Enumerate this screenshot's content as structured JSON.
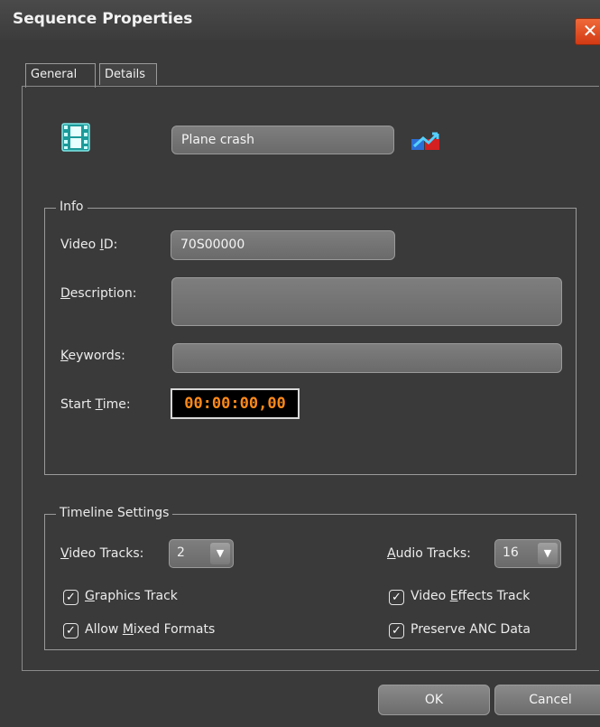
{
  "window": {
    "title": "Sequence Properties",
    "close_glyph": "✕"
  },
  "tabs": [
    {
      "label": "General",
      "active": true
    },
    {
      "label": "Details",
      "active": false
    }
  ],
  "sequence": {
    "name": "Plane crash",
    "icon": "film-strip-icon",
    "link_icon": "relink-icon"
  },
  "info": {
    "legend": "Info",
    "video_id_label_pre": "Video ",
    "video_id_label_u": "I",
    "video_id_label_post": "D:",
    "video_id_value": "70S00000",
    "description_label_u": "D",
    "description_label_post": "escription:",
    "description_value": "",
    "keywords_label_u": "K",
    "keywords_label_post": "eywords:",
    "keywords_value": "",
    "start_time_label_pre": "Start ",
    "start_time_label_u": "T",
    "start_time_label_post": "ime:",
    "start_time_value": "00:00:00,00",
    "timecode_color": "#ff8a1a"
  },
  "timeline": {
    "legend": "Timeline Settings",
    "video_tracks_label_u": "V",
    "video_tracks_label_post": "ideo Tracks:",
    "video_tracks_value": "2",
    "audio_tracks_label_u": "A",
    "audio_tracks_label_post": "udio Tracks:",
    "audio_tracks_value": "16",
    "dropdown_arrow": "▼",
    "checkboxes": {
      "graphics_u": "G",
      "graphics_post": "raphics Track",
      "allow_pre": "Allow ",
      "allow_u": "M",
      "allow_post": "ixed Formats",
      "video_effects_pre": "Video ",
      "video_effects_u": "E",
      "video_effects_post": "ffects Track",
      "preserve_anc": "Preserve ANC Data",
      "check_glyph": "✓"
    }
  },
  "buttons": {
    "ok": "OK",
    "cancel": "Cancel"
  },
  "colors": {
    "close": "#d23a14",
    "panel_bg": "#3a3a3a"
  }
}
